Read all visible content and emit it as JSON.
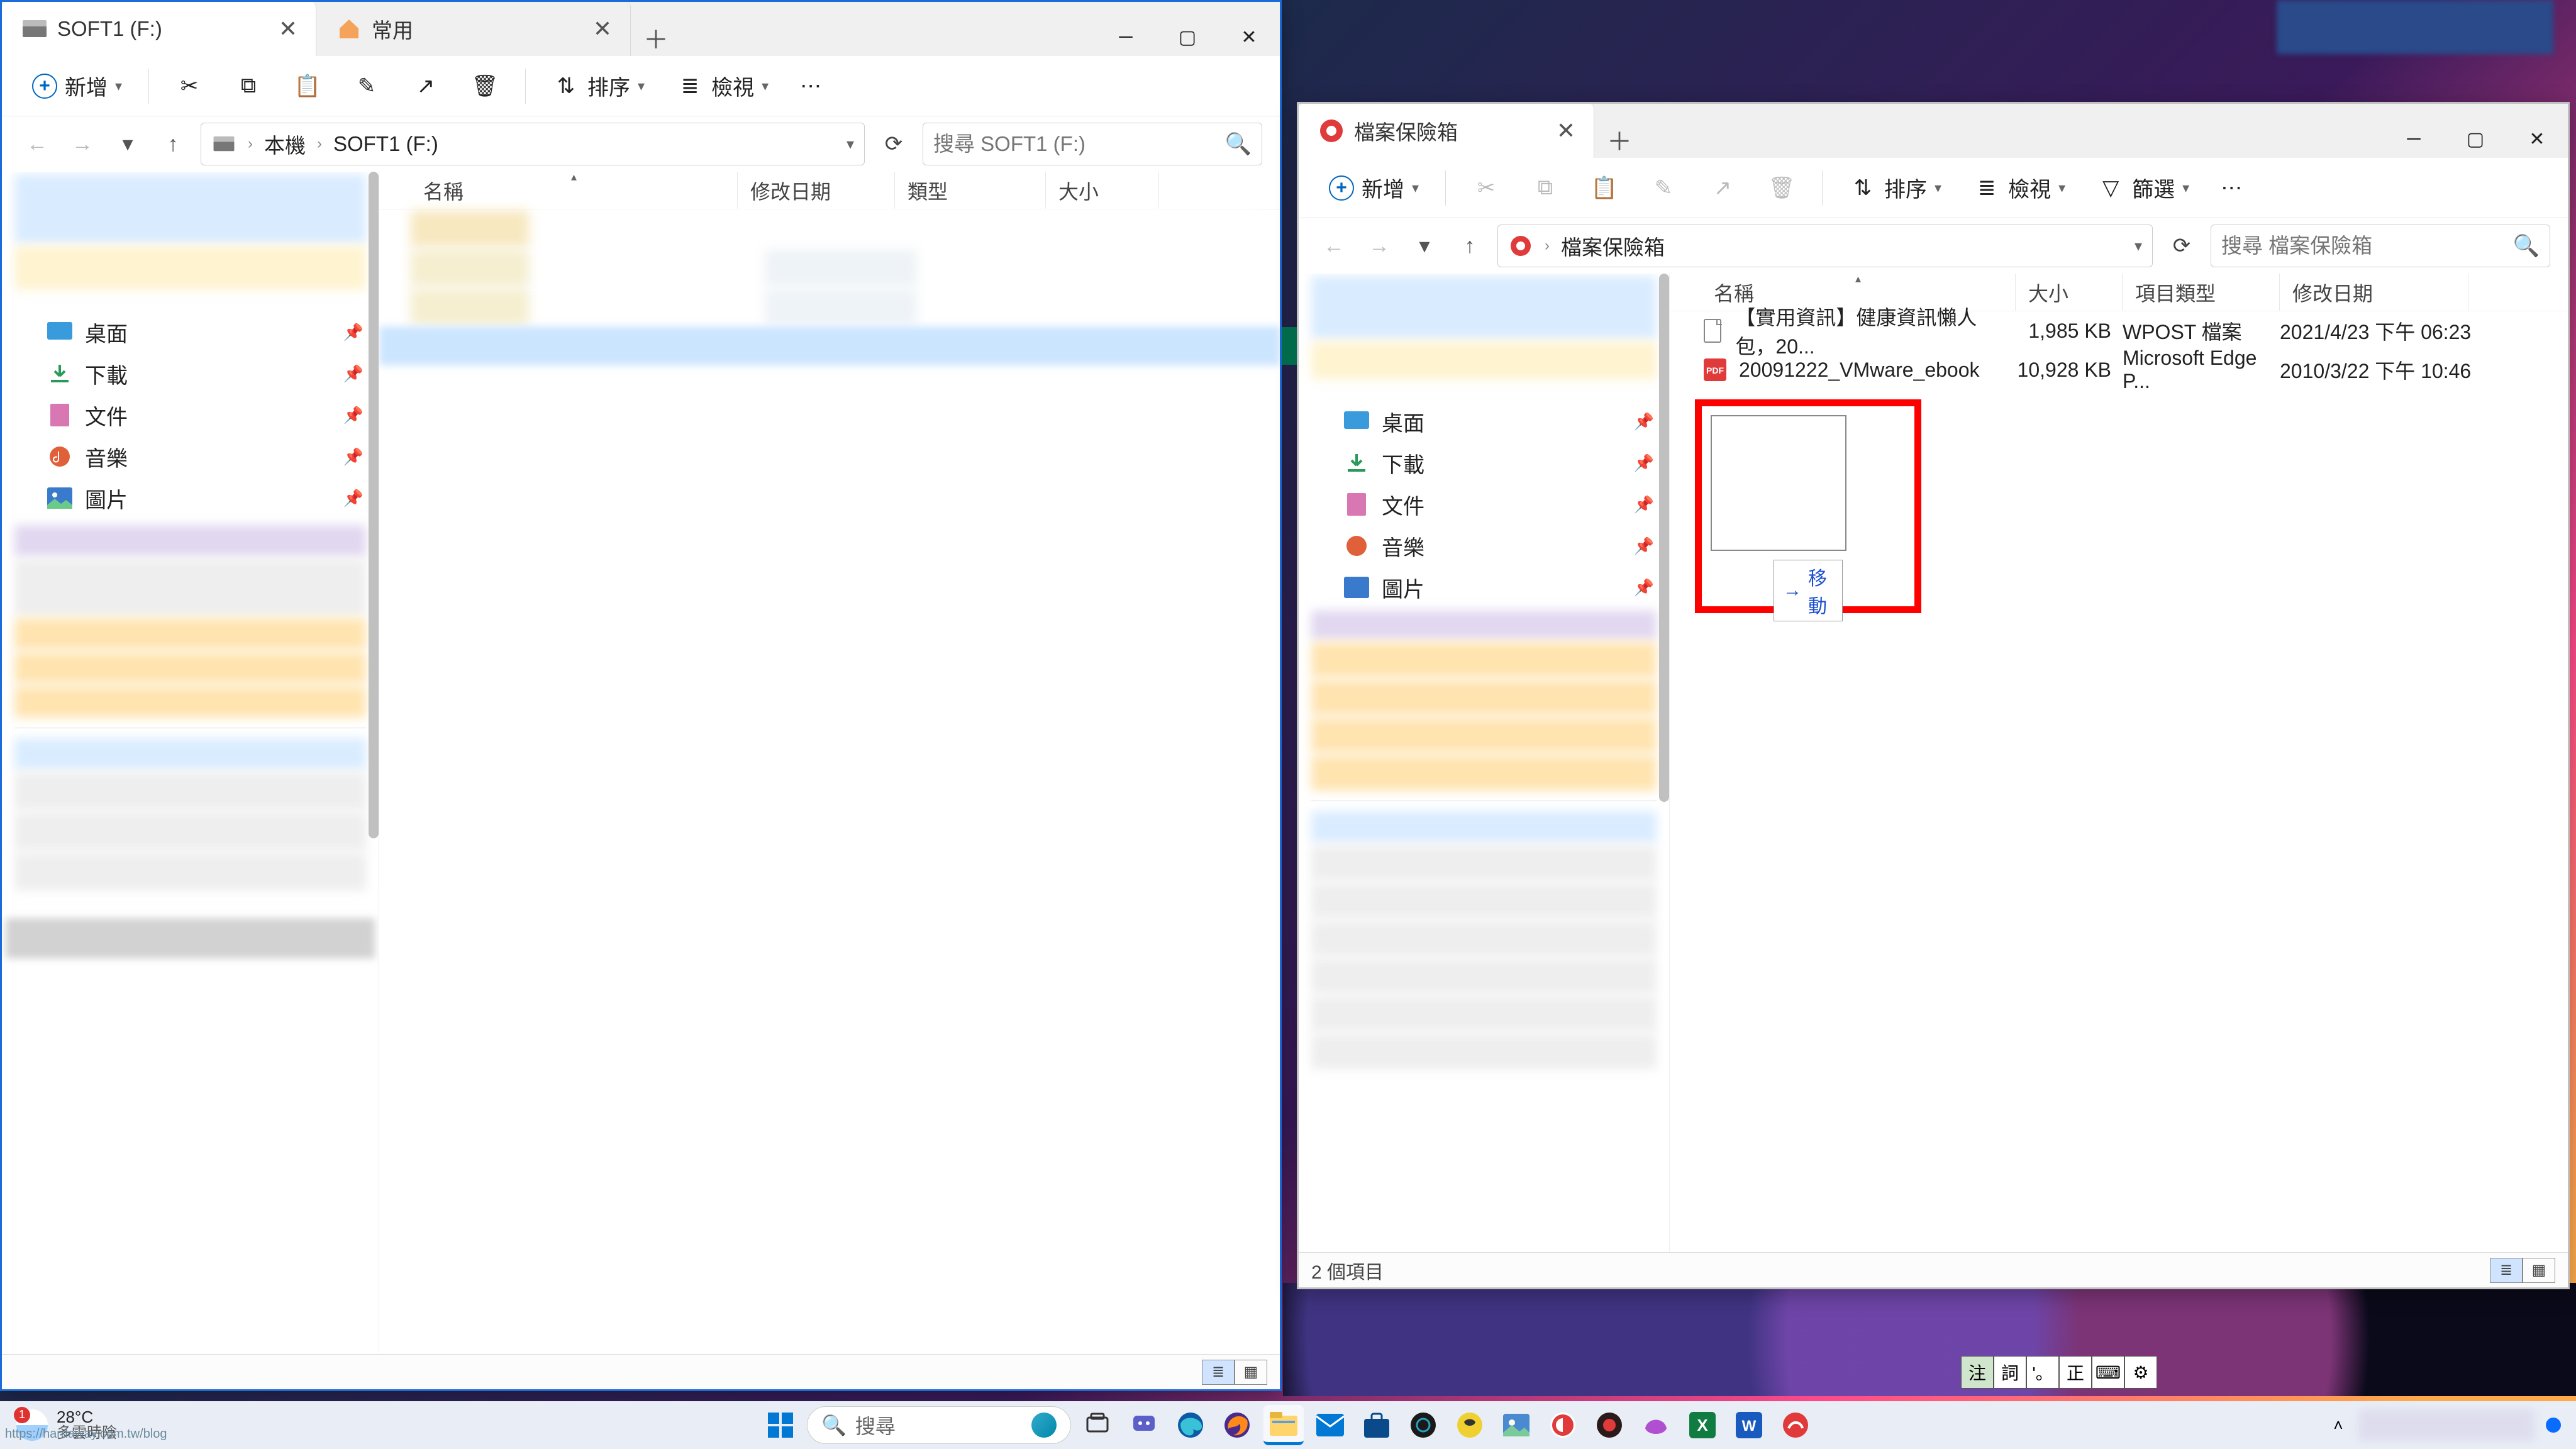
{
  "win1": {
    "tabs": [
      {
        "title": "SOFT1 (F:)",
        "icon": "drive"
      },
      {
        "title": "常用",
        "icon": "home"
      }
    ],
    "toolbar": {
      "new_label": "新增",
      "sort_label": "排序",
      "view_label": "檢視"
    },
    "breadcrumb": {
      "root": "本機",
      "leaf": "SOFT1 (F:)"
    },
    "search_placeholder": "搜尋 SOFT1 (F:)",
    "columns": {
      "name": "名稱",
      "date": "修改日期",
      "type": "類型",
      "size": "大小"
    },
    "nav": {
      "desktop": "桌面",
      "downloads": "下載",
      "documents": "文件",
      "music": "音樂",
      "pictures": "圖片"
    }
  },
  "win2": {
    "tab_title": "檔案保險箱",
    "toolbar": {
      "new_label": "新增",
      "sort_label": "排序",
      "view_label": "檢視",
      "filter_label": "篩選"
    },
    "breadcrumb": {
      "root": "檔案保險箱"
    },
    "search_placeholder": "搜尋 檔案保險箱",
    "columns": {
      "name": "名稱",
      "size": "大小",
      "itemtype": "項目類型",
      "date": "修改日期"
    },
    "nav": {
      "desktop": "桌面",
      "downloads": "下載",
      "documents": "文件",
      "music": "音樂",
      "pictures": "圖片"
    },
    "files": [
      {
        "icon": "doc",
        "name": "【實用資訊】健康資訊懶人包，20...",
        "size": "1,985 KB",
        "type": "WPOST 檔案",
        "date": "2021/4/23 下午 06:23"
      },
      {
        "icon": "pdf",
        "name": "20091222_VMware_ebook",
        "size": "10,928 KB",
        "type": "Microsoft Edge P...",
        "date": "2010/3/22 下午 10:46"
      }
    ],
    "drop_hint": "移動",
    "status": "2 個項目"
  },
  "taskbar": {
    "weather_temp": "28°C",
    "weather_desc": "多雲時陰",
    "search_placeholder": "搜尋",
    "url_hint": "https://hardaway.com.tw/blog"
  },
  "ime": {
    "items": [
      "注",
      "詞",
      "'。",
      "正"
    ]
  }
}
